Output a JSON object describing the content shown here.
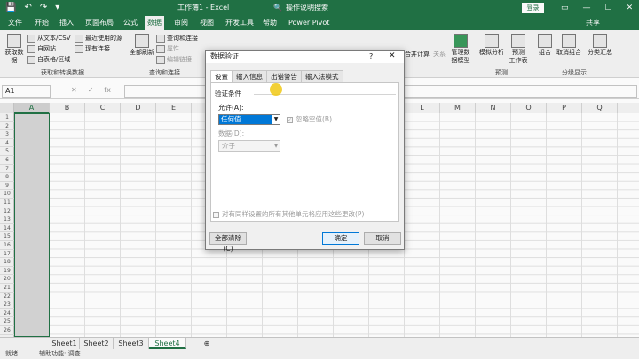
{
  "qat": {
    "save_icon": "💾",
    "undo_icon": "↶",
    "redo_icon": "↷",
    "customize_icon": "▾"
  },
  "title": "工作簿1 - Excel",
  "tell_me": "操作说明搜索",
  "search_icon": "🔍",
  "login_label": "登录",
  "window_controls": {
    "ribbon_display": "▭",
    "minimize": "—",
    "restore": "☐",
    "close": "✕"
  },
  "menu_tabs": [
    "文件",
    "开始",
    "插入",
    "页面布局",
    "公式",
    "数据",
    "审阅",
    "视图",
    "开发工具",
    "帮助",
    "Power Pivot"
  ],
  "active_menu_index": 5,
  "share_label": "共享",
  "ribbon": {
    "get_data": "获取数据",
    "from_text_csv": "从文本/CSV",
    "from_web": "自网站",
    "from_table": "自表格/区域",
    "recent_sources": "最近使用的源",
    "existing_connections": "现有连接",
    "group_get_transform": "获取和转换数据",
    "refresh_all": "全部刷新",
    "queries_connections": "查询和连接",
    "properties": "属性",
    "edit_links": "编辑链接",
    "group_queries": "查询和连接",
    "simulate": "模拟分析",
    "forecast_sheet": "预测\n工作表",
    "group_forecast": "预测",
    "group": "组合",
    "ungroup": "取消组合",
    "subtotal": "分类汇总",
    "group_outline": "分级显示",
    "manage_data_model": "管理数\n据模型",
    "merge_calc": "合并计算",
    "relations": "关系"
  },
  "formula_bar": {
    "name_box": "A1",
    "cancel_icon": "✕",
    "enter_icon": "✓",
    "fx_label": "fx"
  },
  "columns": [
    "A",
    "B",
    "C",
    "D",
    "E",
    "F",
    "G",
    "H",
    "I",
    "J",
    "K",
    "L",
    "M",
    "N",
    "O",
    "P",
    "Q"
  ],
  "rows": [
    "1",
    "2",
    "3",
    "4",
    "5",
    "6",
    "7",
    "8",
    "9",
    "10",
    "11",
    "12",
    "13",
    "14",
    "15",
    "16",
    "17",
    "18",
    "19",
    "20",
    "21",
    "22",
    "23",
    "24",
    "25",
    "26"
  ],
  "sheets": [
    "Sheet1",
    "Sheet2",
    "Sheet3",
    "Sheet4"
  ],
  "active_sheet_index": 3,
  "add_sheet": "⊕",
  "status": {
    "ready": "就绪",
    "accessibility": "辅助功能: 调查"
  },
  "dialog": {
    "title": "数据验证",
    "help": "?",
    "close": "✕",
    "tabs": [
      "设置",
      "输入信息",
      "出错警告",
      "输入法模式"
    ],
    "active_tab_index": 0,
    "criteria_title": "验证条件",
    "allow_label": "允许(A):",
    "allow_value": "任何值",
    "ignore_blank": "忽略空值(B)",
    "data_label": "数据(D):",
    "data_value": "介于",
    "apply_all": "对有同样设置的所有其他单元格应用这些更改(P)",
    "clear_all": "全部清除(C)",
    "ok": "确定",
    "cancel": "取消"
  }
}
